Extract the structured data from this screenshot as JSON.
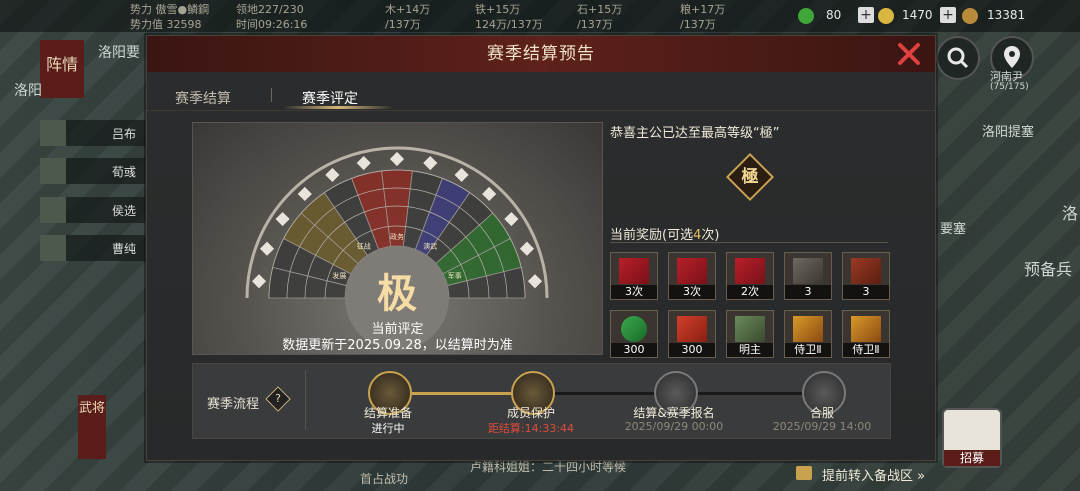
{
  "background": {
    "topbar": {
      "left_text_1": "势力 傲雪●鱗鋼",
      "left_text_2": "势力值 32598",
      "land": "领地227/230",
      "time": "时间09:26:16",
      "res1": "木+14万",
      "res1b": "/137万",
      "res2": "铁+15万",
      "res2b": "124万/137万",
      "res3": "石+15万",
      "res3b": "/137万",
      "res4": "粮+17万",
      "res4b": "/137万",
      "jade": "80",
      "gold": "1470",
      "copper": "13381"
    },
    "map_labels": {
      "city1": "洛阳要",
      "city2": "洛阳",
      "henan": "河南尹",
      "henan_coord": "(75/175)",
      "luoyang_pass": "洛阳提塞",
      "yaosai": "要塞",
      "reserve": "预备兵",
      "luo_right": "洛"
    },
    "left_side_tab": "阵情",
    "left_list": [
      "吕布",
      "荀彧",
      "侯选",
      "曹纯"
    ],
    "left_bottom_tab": "武将",
    "bottom_left_text": "首占战功",
    "bottom_chat": "卢籍科姐姐：二十四小时等候",
    "corner_label": "招募"
  },
  "modal": {
    "title": "赛季结算预告",
    "tabs": [
      {
        "label": "赛季结算",
        "active": false
      },
      {
        "label": "赛季评定",
        "active": true
      }
    ],
    "fan": {
      "grade": "极",
      "current_label": "当前评定",
      "update_text": "数据更新于2025.09.28，以结算时为准",
      "segment_labels": [
        "发展",
        "征战",
        "政务",
        "演武",
        "军事"
      ]
    },
    "congrats": "恭喜主公已达至最高等级“極”",
    "rank_badge": "極",
    "reward_title_prefix": "当前奖励(可选",
    "reward_count": "4",
    "reward_title_suffix": "次)",
    "rewards": [
      {
        "icon": "red-book-icon",
        "qty": "3次"
      },
      {
        "icon": "red-book-icon",
        "qty": "3次"
      },
      {
        "icon": "red-book-icon",
        "qty": "2次"
      },
      {
        "icon": "stone-icon",
        "qty": "3"
      },
      {
        "icon": "wood-icon",
        "qty": "3"
      },
      {
        "icon": "jade-icon",
        "qty": "300"
      },
      {
        "icon": "general-token-icon",
        "qty": "300"
      },
      {
        "icon": "lord-scroll-icon",
        "qty": "明主"
      },
      {
        "icon": "guard-card-icon",
        "qty": "侍卫Ⅱ"
      },
      {
        "icon": "guard-card-icon",
        "qty": "侍卫Ⅱ"
      }
    ],
    "flow": {
      "label": "赛季流程",
      "help": "?",
      "nodes": [
        {
          "icon": "chart-bars-icon",
          "label": "结算准备",
          "sub": "进行中",
          "sub_color": "#ffffff"
        },
        {
          "icon": "horse-rider-icon",
          "label": "成员保护",
          "sub": "距结算:14:33:44",
          "sub_color": "#e04a3a"
        },
        {
          "icon": "chest-icon",
          "label": "结算&赛季报名",
          "sub": "2025/09/29 00:00",
          "sub_color": "#8d877b"
        },
        {
          "icon": "merge-book-icon",
          "label": "合服",
          "sub": "2025/09/29 14:00",
          "sub_color": "#8d877b"
        }
      ]
    }
  },
  "footer_link": "提前转入备战区 »"
}
